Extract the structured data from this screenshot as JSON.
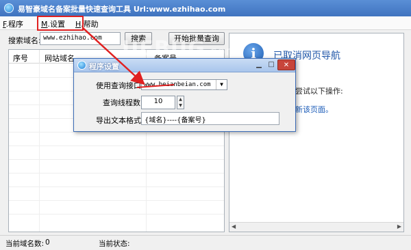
{
  "window": {
    "title": "易智豪域名备案批量快速查询工具 Url:www.ezhihao.com",
    "icon": "app-globe-icon"
  },
  "menu": {
    "items": [
      {
        "mnemonic": "F",
        "label": ".程序"
      },
      {
        "mnemonic": "M",
        "label": ".设置"
      },
      {
        "mnemonic": "H",
        "label": ".帮助"
      }
    ]
  },
  "search": {
    "label": "搜索域名:",
    "value": "www.ezhihao.com",
    "search_button": "搜索",
    "batch_button": "开始批量查询"
  },
  "list": {
    "columns": [
      "序号",
      "网站域名",
      "备案号"
    ]
  },
  "browser": {
    "icon": "info-icon",
    "title": "已取消网页导航",
    "hint": "尝试以下操作:",
    "link": "新该页面。"
  },
  "watermark": {
    "text": "UEBUG",
    "suffix": ".com"
  },
  "dialog": {
    "title": "程序设置",
    "api_label": "使用查询接口:",
    "api_value": "www.beianbeian.com",
    "threads_label": "查询线程数:",
    "threads_value": "10",
    "format_label": "导出文本格式:",
    "format_value": "{域名}----{备案号}"
  },
  "status": {
    "count_label": "当前域名数:",
    "count_value": "0",
    "state_label": "当前状态:"
  },
  "colors": {
    "accent": "#3f73bf",
    "highlight": "#e02020"
  }
}
